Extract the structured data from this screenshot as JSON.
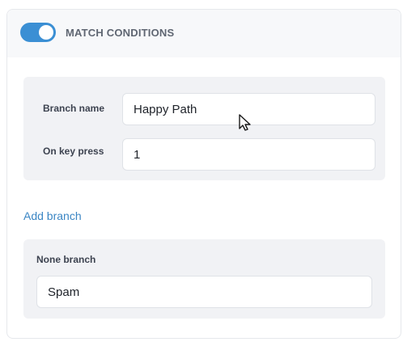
{
  "header": {
    "toggle_on": true,
    "title": "MATCH CONDITIONS"
  },
  "branch": {
    "name_label": "Branch name",
    "name_value": "Happy Path",
    "key_label": "On key press",
    "key_value": "1"
  },
  "add_branch_label": "Add branch",
  "none_branch": {
    "label": "None branch",
    "value": "Spam"
  },
  "colors": {
    "accent": "#3b8fd4",
    "link": "#3b86c4",
    "panel_bg": "#f1f2f5"
  },
  "icons": {
    "cursor": "pointer-cursor-icon"
  }
}
